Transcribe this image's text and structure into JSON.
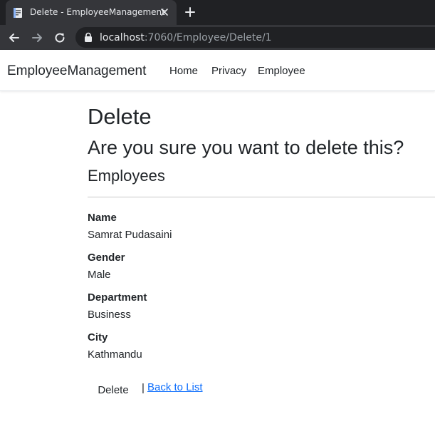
{
  "browser": {
    "tab_title": "Delete - EmployeeManagement",
    "url_host": "localhost",
    "url_path": ":7060/Employee/Delete/1"
  },
  "navbar": {
    "brand": "EmployeeManagement",
    "links": [
      "Home",
      "Privacy",
      "Employee"
    ]
  },
  "page": {
    "title": "Delete",
    "confirm": "Are you sure you want to delete this?",
    "section": "Employees"
  },
  "details": [
    {
      "label": "Name",
      "value": "Samrat Pudasaini"
    },
    {
      "label": "Gender",
      "value": "Male"
    },
    {
      "label": "Department",
      "value": "Business"
    },
    {
      "label": "City",
      "value": "Kathmandu"
    }
  ],
  "actions": {
    "delete_label": "Delete",
    "separator": "|",
    "back_label": "Back to List"
  },
  "colors": {
    "chrome_dark": "#202124",
    "chrome_toolbar": "#35363a",
    "link": "#0d6efd",
    "text": "#212529"
  },
  "icons": [
    "document-icon",
    "close-icon",
    "plus-icon",
    "back-arrow-icon",
    "forward-arrow-icon",
    "reload-icon",
    "lock-icon"
  ]
}
